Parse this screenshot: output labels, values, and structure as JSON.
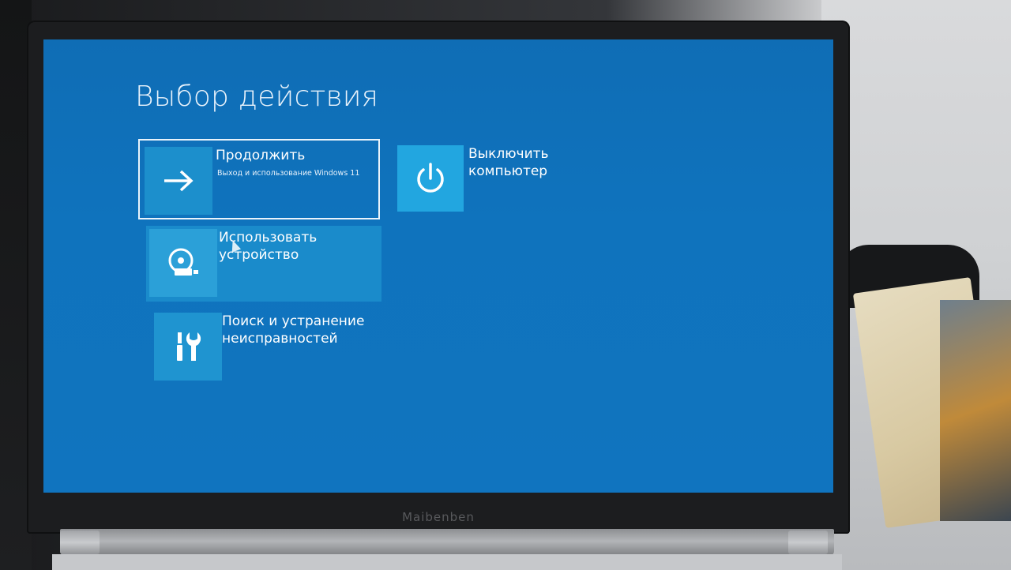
{
  "screen": {
    "title": "Выбор действия",
    "options": [
      {
        "id": "continue",
        "label": "Продолжить",
        "sublabel": "Выход и использование Windows 11",
        "icon": "arrow-right-icon",
        "selected": true
      },
      {
        "id": "use-device",
        "label": "Использовать\nустройство",
        "icon": "disc-drive-icon",
        "selected": false
      },
      {
        "id": "troubleshoot",
        "label": "Поиск и устранение\nнеисправностей",
        "icon": "tools-icon",
        "selected": false
      },
      {
        "id": "shutdown",
        "label": "Выключить\nкомпьютер",
        "icon": "power-icon",
        "selected": false
      }
    ]
  },
  "laptop": {
    "brand": "Maibenben"
  },
  "colors": {
    "screen_bg": "#0f73bd",
    "tile_bg": "#1f94d0",
    "power_tile_bg": "#22a6e0",
    "text": "#ffffff"
  }
}
